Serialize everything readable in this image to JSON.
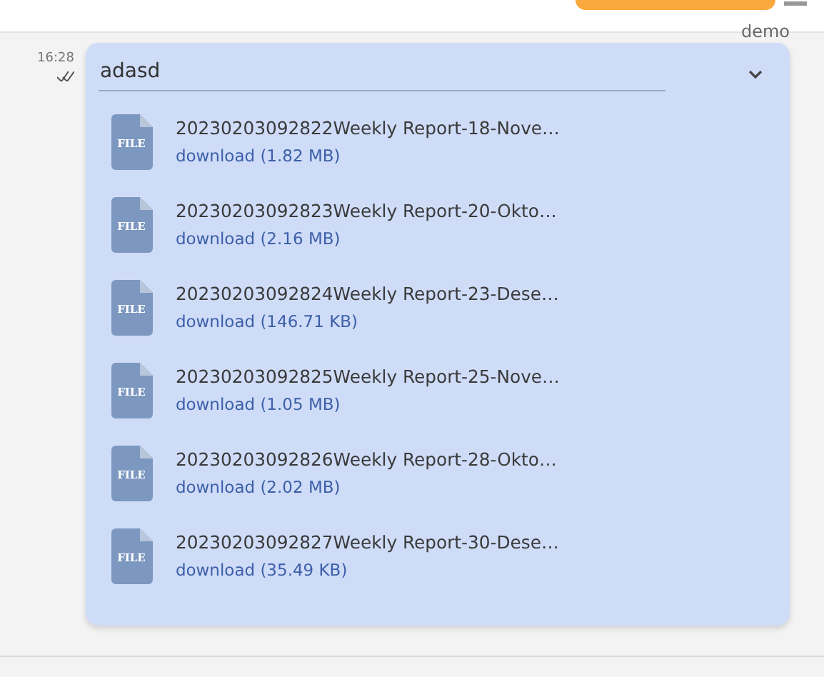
{
  "header": {
    "action_button": {
      "kind": "pill"
    }
  },
  "sender": "demo",
  "message": {
    "time": "16:28",
    "read": true,
    "title": "adasd",
    "files": [
      {
        "icon_text": "FILE",
        "name": "20230203092822Weekly Report-18-Nove…",
        "link": "download (1.82 MB)"
      },
      {
        "icon_text": "FILE",
        "name": "20230203092823Weekly Report-20-Okto…",
        "link": "download (2.16 MB)"
      },
      {
        "icon_text": "FILE",
        "name": "20230203092824Weekly Report-23-Dese…",
        "link": "download (146.71 KB)"
      },
      {
        "icon_text": "FILE",
        "name": "20230203092825Weekly Report-25-Nove…",
        "link": "download (1.05 MB)"
      },
      {
        "icon_text": "FILE",
        "name": "20230203092826Weekly Report-28-Okto…",
        "link": "download (2.02 MB)"
      },
      {
        "icon_text": "FILE",
        "name": "20230203092827Weekly Report-30-Dese…",
        "link": "download (35.49 KB)"
      }
    ]
  }
}
